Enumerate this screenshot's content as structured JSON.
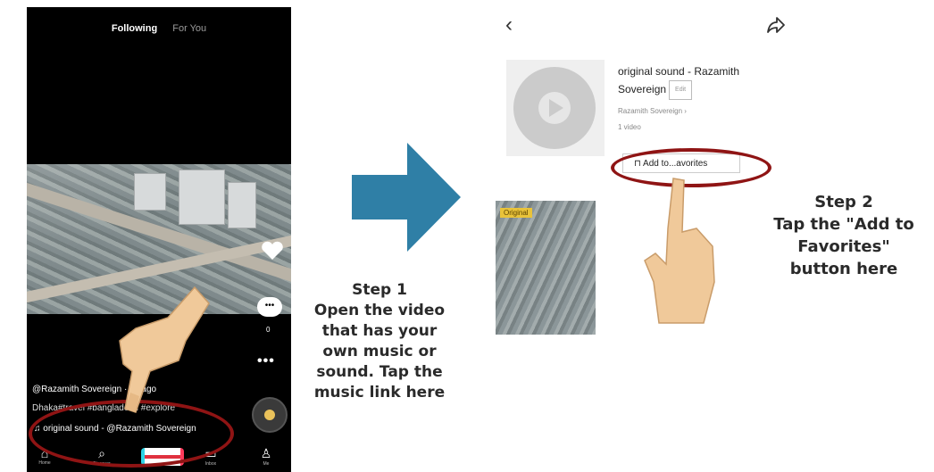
{
  "left_phone": {
    "tabs": [
      "Following",
      "For You"
    ],
    "comment_count": "0",
    "caption_user": "@Razamith Sovereign · 5s ago",
    "caption_desc": "Dhaka#travel #bangladesh #explore",
    "sound_text": "original sound - @Razamith Sovereign",
    "nav": [
      "Home",
      "Discover",
      "",
      "Inbox",
      "Me"
    ]
  },
  "right_phone": {
    "sound_title": "original sound - Razamith",
    "sound_title2": "Sovereign",
    "edit_label": "Edit",
    "author": "Razamith Sovereign",
    "video_count": "1 video",
    "favorites_button": "Add to...avorites",
    "thumb_tag": "Original"
  },
  "step1": {
    "title": "Step 1",
    "lines": [
      "Open the video",
      "that has your",
      "own music or",
      "sound. Tap the",
      "music link here"
    ]
  },
  "step2": {
    "title": "Step 2",
    "lines": [
      "Tap the \"Add to",
      "Favorites\"",
      "button here"
    ]
  },
  "colors": {
    "arrow": "#2f7fa6",
    "highlight": "#8f1414",
    "hand": "#f0c99a"
  },
  "icons": [
    "back-icon",
    "share-icon",
    "heart-icon",
    "comment-icon",
    "more-icon",
    "music-note-icon",
    "home-icon",
    "search-icon",
    "inbox-icon",
    "profile-icon",
    "bookmark-icon",
    "play-icon"
  ]
}
